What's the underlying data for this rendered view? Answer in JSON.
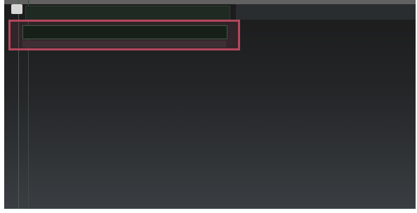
{
  "window": {
    "background_top": "#1b1b1b",
    "background_bottom": "#3a3e42"
  },
  "list": {
    "rows": [
      {
        "label": "",
        "state": "normal"
      },
      {
        "label": "",
        "state": "selected"
      }
    ]
  },
  "colors": {
    "selection_border": "#b4475e",
    "row_background": "#1f2a22",
    "selected_row_background": "#162019",
    "gutter_line": "#4e5a52"
  },
  "icons": {
    "row_icon": "file-icon"
  }
}
